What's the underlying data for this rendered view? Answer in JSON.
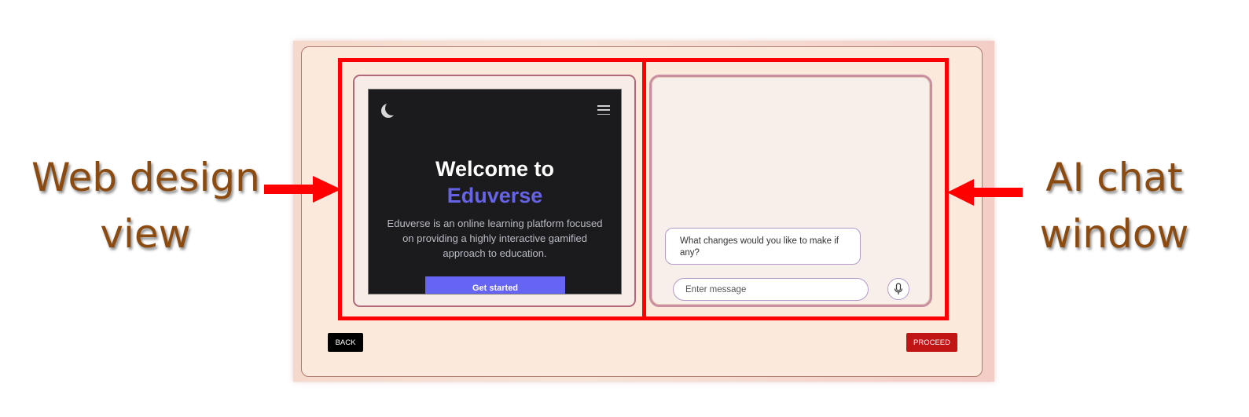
{
  "annotations": {
    "left_label": "Web design view",
    "left_line1": "Web design",
    "left_line2": "view",
    "right_line1": "AI chat",
    "right_line2": "window",
    "box_color": "#ff0000",
    "label_color": "#8b4a10"
  },
  "design_view": {
    "icons": {
      "theme": "moon-icon",
      "menu": "hamburger-menu-icon"
    },
    "title_line1": "Welcome to",
    "title_brand": "Eduverse",
    "description": "Eduverse is an online learning platform focused on providing a highly interactive gamified approach to education.",
    "cta_label": "Get started",
    "colors": {
      "background": "#1b1b1d",
      "brand": "#6663e6",
      "cta": "#6664f4"
    }
  },
  "chat": {
    "messages": [
      {
        "role": "assistant",
        "text": "What changes would you like to make if any?"
      }
    ],
    "input_placeholder": "Enter message",
    "mic_icon": "microphone-icon"
  },
  "footer": {
    "back_label": "BACK",
    "proceed_label": "PROCEED",
    "colors": {
      "back": "#000000",
      "proceed": "#c11414"
    }
  }
}
